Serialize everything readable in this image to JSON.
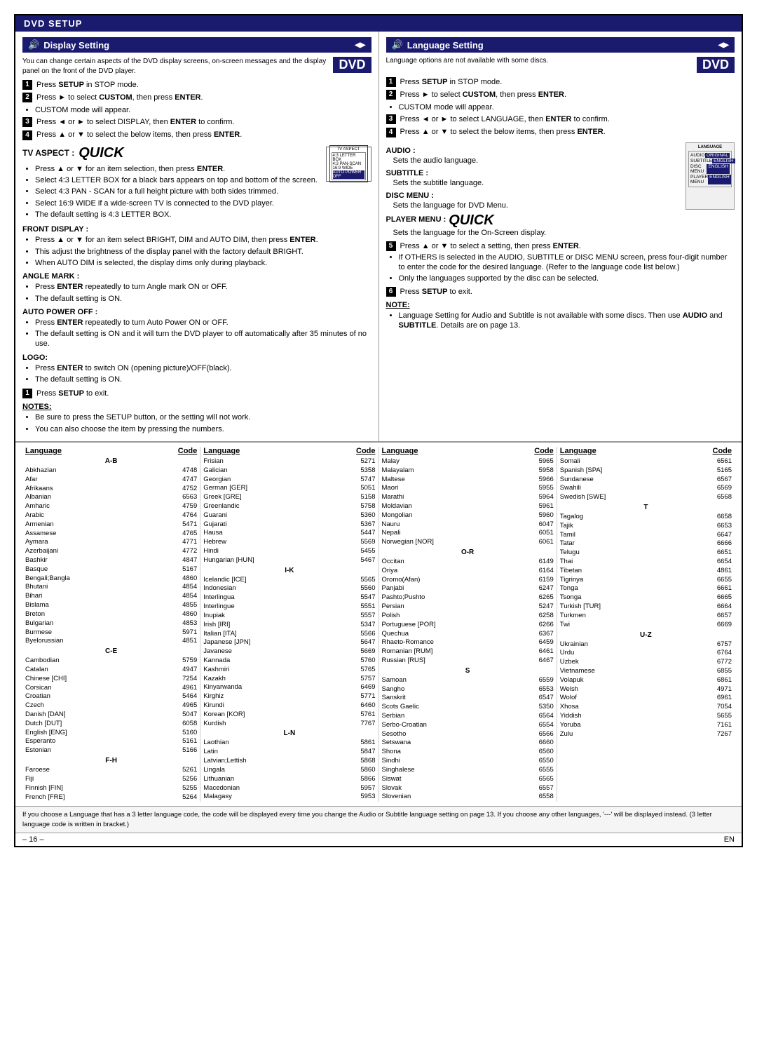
{
  "header": {
    "title": "DVD SETUP"
  },
  "display_setting": {
    "section_title": "Display Setting",
    "dvd_badge": "DVD",
    "intro": "You can change certain aspects of the DVD display screens, on-screen messages and the display panel on the front of the DVD player.",
    "steps": [
      {
        "num": "1",
        "text": "Press SETUP in STOP mode."
      },
      {
        "num": "2",
        "text": "Press ► to select CUSTOM, then press ENTER.",
        "sub": [
          "CUSTOM mode will appear."
        ]
      },
      {
        "num": "3",
        "text": "Press ◄ or ► to select DISPLAY, then ENTER to confirm."
      },
      {
        "num": "4",
        "text": "Press ▲ or ▼ to select the below items, then press ENTER."
      }
    ],
    "tv_aspect_label": "TV ASPECT :",
    "tv_aspect_quick": "QUICK",
    "tv_aspect_subs": [
      "Press ▲ or ▼ for an item selection, then press ENTER.",
      "Select 4:3 LETTER BOX for a black bars appears on top and bottom of the screen.",
      "Select 4:3 PAN - SCAN for a full height picture with both sides trimmed.",
      "Select 16:9 WIDE if a wide-screen TV is connected to the DVD player.",
      "The default setting is 4:3 LETTER BOX."
    ],
    "front_display_title": "FRONT DISPLAY :",
    "front_display_subs": [
      "Press ▲ or ▼ for an item select BRIGHT, DIM and AUTO DIM, then press ENTER.",
      "This adjust the brightness of the display panel with the factory default BRIGHT.",
      "When AUTO DIM is selected, the display dims only during playback."
    ],
    "angle_mark_title": "ANGLE MARK :",
    "angle_mark_subs": [
      "Press ENTER repeatedly to turn Angle mark ON or OFF.",
      "The default setting is ON."
    ],
    "auto_power_off_title": "AUTO POWER OFF :",
    "auto_power_off_subs": [
      "Press ENTER repeatedly to turn Auto Power ON or OFF.",
      "The default setting is ON and it will turn the DVD player to off automatically after 35 minutes of no use."
    ],
    "logo_title": "LOGO:",
    "logo_subs": [
      "Press ENTER to switch ON (opening picture)/OFF(black).",
      "The default setting is ON."
    ],
    "step5": "Press SETUP to exit.",
    "notes_title": "NOTES:",
    "notes": [
      "Be sure to press the SETUP button, or the setting will not work.",
      "You can also choose the item by pressing the numbers."
    ]
  },
  "language_setting": {
    "section_title": "Language Setting",
    "dvd_badge": "DVD",
    "lang_options_note": "Language options are not available with some discs.",
    "steps": [
      {
        "num": "1",
        "text": "Press SETUP in STOP mode."
      },
      {
        "num": "2",
        "text": "Press ► to select CUSTOM, then press ENTER.",
        "sub": [
          "CUSTOM mode will appear."
        ]
      },
      {
        "num": "3",
        "text": "Press ◄ or ► to select LANGUAGE, then ENTER to confirm."
      },
      {
        "num": "4",
        "text": "Press ▲ or ▼ to select the below items, then press ENTER."
      }
    ],
    "audio_title": "AUDIO :",
    "audio_sub": "Sets the audio language.",
    "subtitle_title": "SUBTITLE :",
    "subtitle_sub": "Sets the subtitle language.",
    "disc_menu_title": "DISC MENU :",
    "disc_menu_sub": "Sets the language for DVD Menu.",
    "player_menu_label": "PLAYER MENU :",
    "player_menu_quick": "QUICK",
    "player_menu_sub": "Sets the language for the On-Screen display.",
    "step5": "Press ▲ or ▼ to select a setting, then press ENTER.",
    "step5_num": "5",
    "step5_subs": [
      "If OTHERS is selected in the AUDIO, SUBTITLE or DISC MENU screen, press four-digit number to enter the code for the desired language. (Refer to the language code list below.)",
      "Only the languages supported by the disc can be selected."
    ],
    "step6_num": "6",
    "step6": "Press SETUP to exit.",
    "note_title": "NOTE:",
    "note": "Language Setting for Audio and Subtitle is not available with some discs. Then use AUDIO and SUBTITLE. Details are on page 13."
  },
  "language_table": {
    "columns": [
      {
        "header_lang": "Language",
        "header_code": "Code",
        "entries": [
          {
            "section": "A-B"
          },
          {
            "lang": "Abkhazian",
            "code": "4748"
          },
          {
            "lang": "Afar",
            "code": "4747"
          },
          {
            "lang": "Afrikaans",
            "code": "4752"
          },
          {
            "lang": "Albanian",
            "code": "6563"
          },
          {
            "lang": "Amharic",
            "code": "4759"
          },
          {
            "lang": "Arabic",
            "code": "4764"
          },
          {
            "lang": "Armenian",
            "code": "5471"
          },
          {
            "lang": "Assamese",
            "code": "4765"
          },
          {
            "lang": "Aymara",
            "code": "4771"
          },
          {
            "lang": "Azerbaijani",
            "code": "4772"
          },
          {
            "lang": "Bashkir",
            "code": "4847"
          },
          {
            "lang": "Basque",
            "code": "5167"
          },
          {
            "lang": "Bengali;Bangla",
            "code": "4860"
          },
          {
            "lang": "Bhutani",
            "code": "4854"
          },
          {
            "lang": "Bihari",
            "code": "4854"
          },
          {
            "lang": "Bislama",
            "code": "4855"
          },
          {
            "lang": "Breton",
            "code": "4860"
          },
          {
            "lang": "Bulgarian",
            "code": "4853"
          },
          {
            "lang": "Burmese",
            "code": "5971"
          },
          {
            "lang": "Byelorussian",
            "code": "4851"
          },
          {
            "section": "C-E"
          },
          {
            "lang": "Cambodian",
            "code": "5759"
          },
          {
            "lang": "Catalan",
            "code": "4947"
          },
          {
            "lang": "Chinese [CHI]",
            "code": "7254"
          },
          {
            "lang": "Corsican",
            "code": "4961"
          },
          {
            "lang": "Croatian",
            "code": "5464"
          },
          {
            "lang": "Czech",
            "code": "4965"
          },
          {
            "lang": "Danish [DAN]",
            "code": "5047"
          },
          {
            "lang": "Dutch [DUT]",
            "code": "6058"
          },
          {
            "lang": "English [ENG]",
            "code": "5160"
          },
          {
            "lang": "Esperanto",
            "code": "5161"
          },
          {
            "lang": "Estonian",
            "code": "5166"
          },
          {
            "section": "F-H"
          },
          {
            "lang": "Faroese",
            "code": "5261"
          },
          {
            "lang": "Fiji",
            "code": "5256"
          },
          {
            "lang": "Finnish [FIN]",
            "code": "5255"
          },
          {
            "lang": "French [FRE]",
            "code": "5264"
          }
        ]
      },
      {
        "header_lang": "Language",
        "header_code": "Code",
        "entries": [
          {
            "lang": "Frisian",
            "code": "5271"
          },
          {
            "lang": "Galician",
            "code": "5358"
          },
          {
            "lang": "Georgian",
            "code": "5747"
          },
          {
            "lang": "German [GER]",
            "code": "5051"
          },
          {
            "lang": "Greek [GRE]",
            "code": "5158"
          },
          {
            "lang": "Greenlandic",
            "code": "5758"
          },
          {
            "lang": "Guarani",
            "code": "5360"
          },
          {
            "lang": "Gujarati",
            "code": "5367"
          },
          {
            "lang": "Hausa",
            "code": "5447"
          },
          {
            "lang": "Hebrew",
            "code": "5569"
          },
          {
            "lang": "Hindi",
            "code": "5455"
          },
          {
            "lang": "Hungarian [HUN]",
            "code": "5467"
          },
          {
            "section": "I-K"
          },
          {
            "lang": "Icelandic [ICE]",
            "code": "5565"
          },
          {
            "lang": "Indonesian",
            "code": "5560"
          },
          {
            "lang": "Interlingua",
            "code": "5547"
          },
          {
            "lang": "Interlingue",
            "code": "5551"
          },
          {
            "lang": "Inupiak",
            "code": "5557"
          },
          {
            "lang": "Irish [IRI]",
            "code": "5347"
          },
          {
            "lang": "Italian [ITA]",
            "code": "5566"
          },
          {
            "lang": "Japanese [JPN]",
            "code": "5647"
          },
          {
            "lang": "Javanese",
            "code": "5669"
          },
          {
            "lang": "Kannada",
            "code": "5760"
          },
          {
            "lang": "Kashmiri",
            "code": "5765"
          },
          {
            "lang": "Kazakh",
            "code": "5757"
          },
          {
            "lang": "Kinyarwanda",
            "code": "6469"
          },
          {
            "lang": "Kirghiz",
            "code": "5771"
          },
          {
            "lang": "Kirundi",
            "code": "6460"
          },
          {
            "lang": "Korean [KOR]",
            "code": "5761"
          },
          {
            "lang": "Kurdish",
            "code": "7767"
          },
          {
            "section": "L-N"
          },
          {
            "lang": "Laothian",
            "code": "5861"
          },
          {
            "lang": "Latin",
            "code": "5847"
          },
          {
            "lang": "Latvian;Lettish",
            "code": "5868"
          },
          {
            "lang": "Lingala",
            "code": "5860"
          },
          {
            "lang": "Lithuanian",
            "code": "5866"
          },
          {
            "lang": "Macedonian",
            "code": "5957"
          },
          {
            "lang": "Malagasy",
            "code": "5953"
          }
        ]
      },
      {
        "header_lang": "Language",
        "header_code": "Code",
        "entries": [
          {
            "lang": "Malay",
            "code": "5965"
          },
          {
            "lang": "Malayalam",
            "code": "5958"
          },
          {
            "lang": "Maltese",
            "code": "5966"
          },
          {
            "lang": "Maori",
            "code": "5955"
          },
          {
            "lang": "Marathi",
            "code": "5964"
          },
          {
            "lang": "Moldavian",
            "code": "5961"
          },
          {
            "lang": "Mongolian",
            "code": "5960"
          },
          {
            "lang": "Nauru",
            "code": "6047"
          },
          {
            "lang": "Nepali",
            "code": "6051"
          },
          {
            "lang": "Norwegian [NOR]",
            "code": "6061"
          },
          {
            "section": "O-R"
          },
          {
            "lang": "Occitan",
            "code": "6149"
          },
          {
            "lang": "Oriya",
            "code": "6164"
          },
          {
            "lang": "Oromo(Afan)",
            "code": "6159"
          },
          {
            "lang": "Panjabi",
            "code": "6247"
          },
          {
            "lang": "Pashto;Pushto",
            "code": "6265"
          },
          {
            "lang": "Persian",
            "code": "5247"
          },
          {
            "lang": "Polish",
            "code": "6258"
          },
          {
            "lang": "Portuguese [POR]",
            "code": "6266"
          },
          {
            "lang": "Quechua",
            "code": "6367"
          },
          {
            "lang": "Rhaeto-Romance",
            "code": "6459"
          },
          {
            "lang": "Romanian [RUM]",
            "code": "6461"
          },
          {
            "lang": "Russian [RUS]",
            "code": "6467"
          },
          {
            "section": "S"
          },
          {
            "lang": "Samoan",
            "code": "6559"
          },
          {
            "lang": "Sangho",
            "code": "6553"
          },
          {
            "lang": "Sanskrit",
            "code": "6547"
          },
          {
            "lang": "Scots Gaelic",
            "code": "5350"
          },
          {
            "lang": "Serbian",
            "code": "6564"
          },
          {
            "lang": "Serbo-Croatian",
            "code": "6554"
          },
          {
            "lang": "Sesotho",
            "code": "6566"
          },
          {
            "lang": "Setswana",
            "code": "6660"
          },
          {
            "lang": "Shona",
            "code": "6560"
          },
          {
            "lang": "Sindhi",
            "code": "6550"
          },
          {
            "lang": "Singhalese",
            "code": "6555"
          },
          {
            "lang": "Siswat",
            "code": "6565"
          },
          {
            "lang": "Slovak",
            "code": "6557"
          },
          {
            "lang": "Slovenian",
            "code": "6558"
          }
        ]
      },
      {
        "header_lang": "Language",
        "header_code": "Code",
        "entries": [
          {
            "lang": "Somali",
            "code": "6561"
          },
          {
            "lang": "Spanish [SPA]",
            "code": "5165"
          },
          {
            "lang": "Sundanese",
            "code": "6567"
          },
          {
            "lang": "Swahili",
            "code": "6569"
          },
          {
            "lang": "Swedish [SWE]",
            "code": "6568"
          },
          {
            "section": "T"
          },
          {
            "lang": "Tagalog",
            "code": "6658"
          },
          {
            "lang": "Tajik",
            "code": "6653"
          },
          {
            "lang": "Tamil",
            "code": "6647"
          },
          {
            "lang": "Tatar",
            "code": "6666"
          },
          {
            "lang": "Telugu",
            "code": "6651"
          },
          {
            "lang": "Thai",
            "code": "6654"
          },
          {
            "lang": "Tibetan",
            "code": "4861"
          },
          {
            "lang": "Tigrinya",
            "code": "6655"
          },
          {
            "lang": "Tonga",
            "code": "6661"
          },
          {
            "lang": "Tsonga",
            "code": "6665"
          },
          {
            "lang": "Turkish [TUR]",
            "code": "6664"
          },
          {
            "lang": "Turkmen",
            "code": "6657"
          },
          {
            "lang": "Twi",
            "code": "6669"
          },
          {
            "section": "U-Z"
          },
          {
            "lang": "Ukrainian",
            "code": "6757"
          },
          {
            "lang": "Urdu",
            "code": "6764"
          },
          {
            "lang": "Uzbek",
            "code": "6772"
          },
          {
            "lang": "Vietnamese",
            "code": "6855"
          },
          {
            "lang": "Volapuk",
            "code": "6861"
          },
          {
            "lang": "Welsh",
            "code": "4971"
          },
          {
            "lang": "Wolof",
            "code": "6961"
          },
          {
            "lang": "Xhosa",
            "code": "7054"
          },
          {
            "lang": "Yiddish",
            "code": "5655"
          },
          {
            "lang": "Yoruba",
            "code": "7161"
          },
          {
            "lang": "Zulu",
            "code": "7267"
          }
        ]
      }
    ]
  },
  "footer": {
    "note": "If you choose a Language that has a 3 letter language code, the code will be displayed every time you change the Audio or Subtitle language setting on page 13. If you choose any other languages, '---' will be displayed instead. (3 letter language code is written in bracket.)",
    "page_num": "– 16 –",
    "en_label": "EN"
  }
}
